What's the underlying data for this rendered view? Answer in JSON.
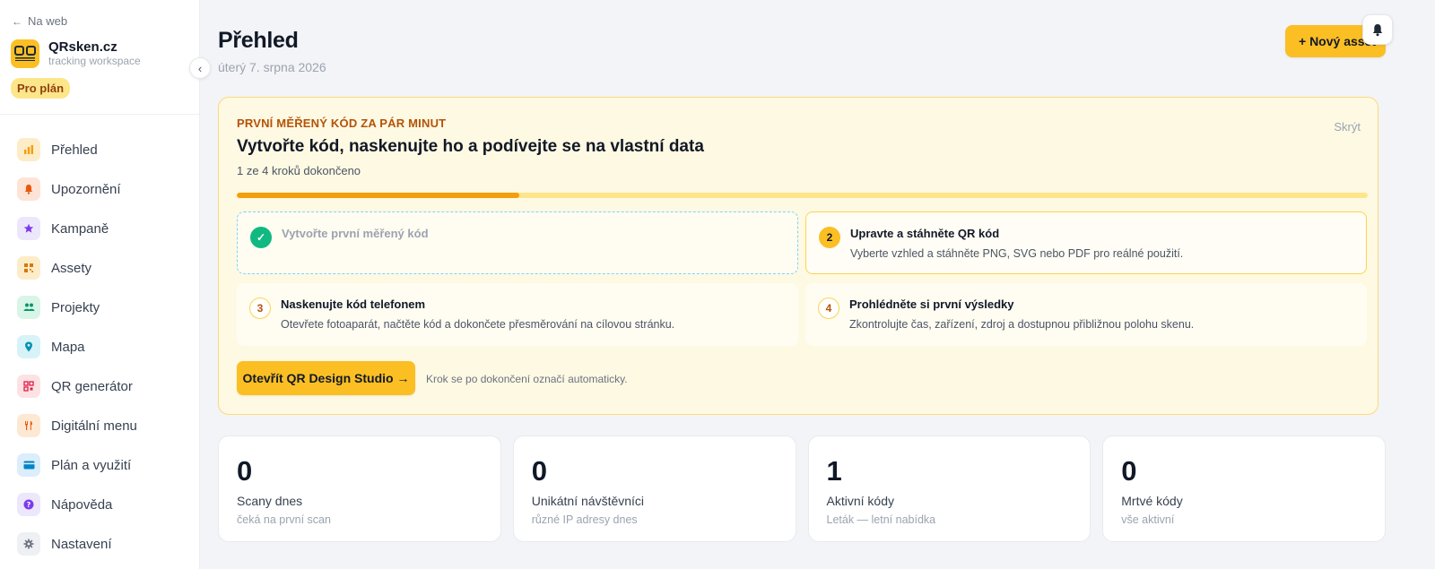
{
  "sidebar": {
    "back_label": "Na web",
    "brand": {
      "logo_text": "QR",
      "name": "QRsken.cz",
      "subtitle": "tracking workspace"
    },
    "plan_badge": "Pro plán",
    "items": [
      {
        "label": "Přehled",
        "icon": "chart-bar-icon",
        "icon_bg": "#fdecc8",
        "icon_color": "#f59e0b"
      },
      {
        "label": "Upozornění",
        "icon": "bell-icon",
        "icon_bg": "#fde4d6",
        "icon_color": "#ea580c"
      },
      {
        "label": "Kampaně",
        "icon": "star-icon",
        "icon_bg": "#ece7fb",
        "icon_color": "#7c3aed"
      },
      {
        "label": "Assety",
        "icon": "qr-code-icon",
        "icon_bg": "#fdecc8",
        "icon_color": "#d97706"
      },
      {
        "label": "Projekty",
        "icon": "users-icon",
        "icon_bg": "#d8f5e7",
        "icon_color": "#059669"
      },
      {
        "label": "Mapa",
        "icon": "map-pin-icon",
        "icon_bg": "#d7f3f8",
        "icon_color": "#0891b2"
      },
      {
        "label": "QR generátor",
        "icon": "qr-grid-icon",
        "icon_bg": "#fde2e4",
        "icon_color": "#e11d48"
      },
      {
        "label": "Digitální menu",
        "icon": "utensils-icon",
        "icon_bg": "#fde9d3",
        "icon_color": "#ea580c"
      },
      {
        "label": "Plán a využití",
        "icon": "credit-card-icon",
        "icon_bg": "#dcedfb",
        "icon_color": "#0284c7"
      },
      {
        "label": "Nápověda",
        "icon": "help-icon",
        "icon_bg": "#ece7fb",
        "icon_color": "#7c3aed"
      },
      {
        "label": "Nastavení",
        "icon": "gear-icon",
        "icon_bg": "#eef0f3",
        "icon_color": "#6b7280"
      }
    ]
  },
  "header": {
    "title": "Přehled",
    "date": "úterý 7. srpna 2026",
    "new_asset_label": "+ Nový asset"
  },
  "onboarding": {
    "eyebrow": "PRVNÍ MĚŘENÝ KÓD ZA PÁR MINUT",
    "hide_label": "Skrýt",
    "title": "Vytvořte kód, naskenujte ho a podívejte se na vlastní data",
    "progress_text": "1 ze 4 kroků dokončeno",
    "progress_value": 0.25,
    "steps": [
      {
        "number": "✓",
        "title": "Vytvořte první měřený kód",
        "description": "",
        "state": "done"
      },
      {
        "number": "2",
        "title": "Upravte a stáhněte QR kód",
        "description": "Vyberte vzhled a stáhněte PNG, SVG nebo PDF pro reálné použití.",
        "state": "active"
      },
      {
        "number": "3",
        "title": "Naskenujte kód telefonem",
        "description": "Otevřete fotoaparát, načtěte kód a dokončete přesměrování na cílovou stránku.",
        "state": "todo"
      },
      {
        "number": "4",
        "title": "Prohlédněte si první výsledky",
        "description": "Zkontrolujte čas, zařízení, zdroj a dostupnou přibližnou polohu skenu.",
        "state": "todo"
      }
    ],
    "cta_label": "Otevřít QR Design Studio →",
    "cta_note": "Krok se po dokončení označí automaticky."
  },
  "stats": [
    {
      "value": "0",
      "label": "Scany dnes",
      "sub": "čeká na první scan"
    },
    {
      "value": "0",
      "label": "Unikátní návštěvníci",
      "sub": "různé IP adresy dnes"
    },
    {
      "value": "1",
      "label": "Aktivní kódy",
      "sub": "Leták — letní nabídka"
    },
    {
      "value": "0",
      "label": "Mrtvé kódy",
      "sub": "vše aktivní"
    }
  ],
  "colors": {
    "accent": "#fbbf24",
    "accent_dark": "#f59e0b",
    "success": "#10b981",
    "eyebrow": "#b45309"
  }
}
